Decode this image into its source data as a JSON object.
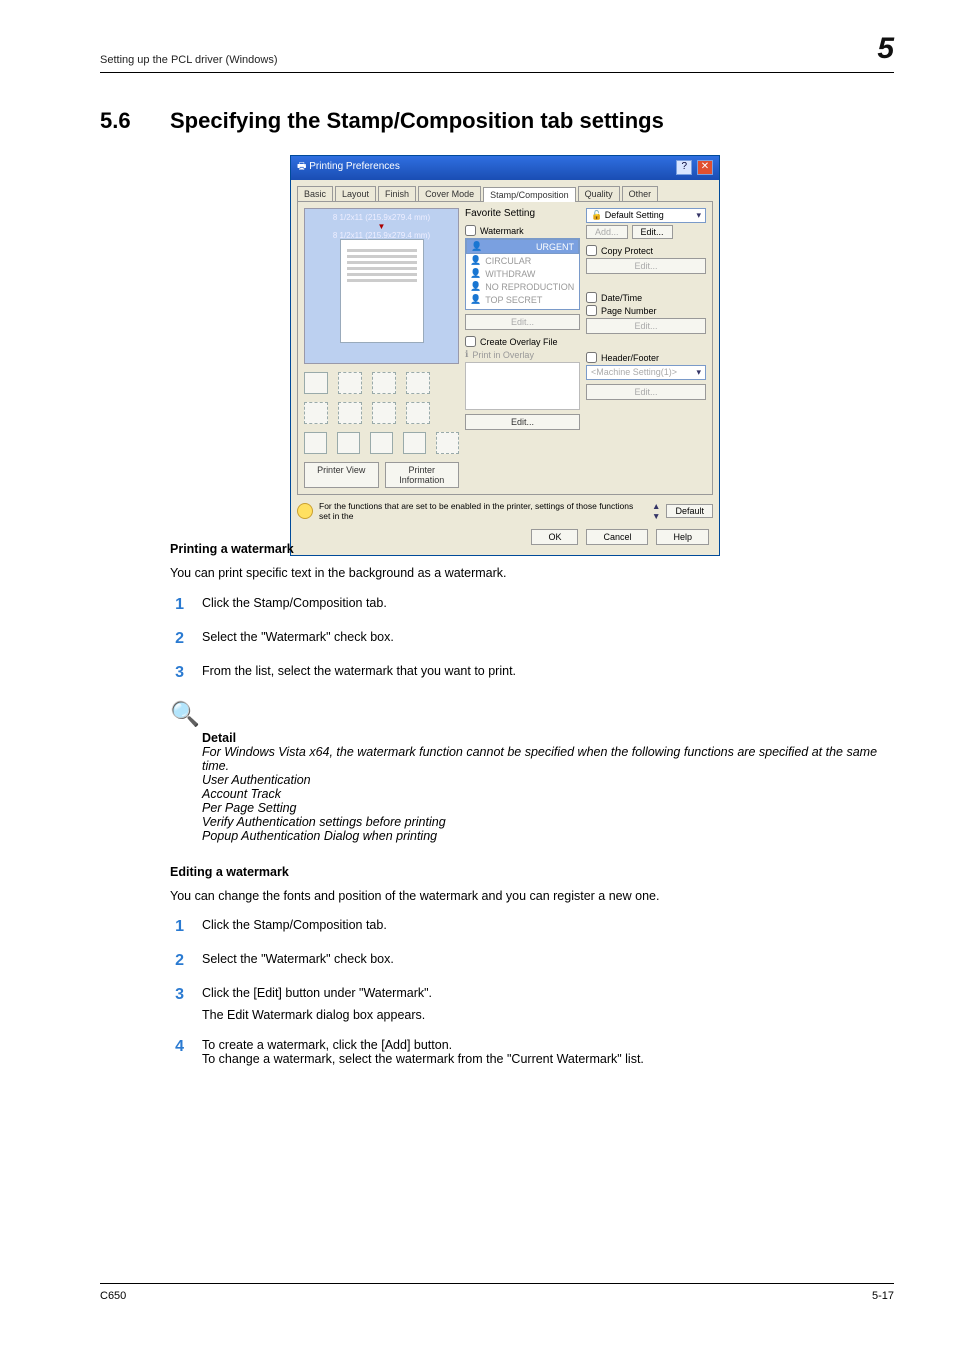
{
  "header": {
    "path": "Setting up the PCL driver (Windows)",
    "chapter_num": "5"
  },
  "section": {
    "number": "5.6",
    "title": "Specifying the Stamp/Composition tab settings"
  },
  "dialog": {
    "title": "Printing Preferences",
    "tabs": [
      "Basic",
      "Layout",
      "Finish",
      "Cover Mode",
      "Stamp/Composition",
      "Quality",
      "Other"
    ],
    "active_tab_index": 4,
    "preview": {
      "line1": "8 1/2x11 (215.9x279.4 mm)",
      "line2": "8 1/2x11 (215.9x279.4 mm)"
    },
    "left_buttons": {
      "printer_view": "Printer View",
      "printer_info": "Printer Information"
    },
    "favorite": {
      "label": "Favorite Setting",
      "value": "Default Setting",
      "add": "Add...",
      "edit": "Edit..."
    },
    "watermark": {
      "label": "Watermark",
      "items": [
        "URGENT",
        "CIRCULAR",
        "WITHDRAW",
        "NO REPRODUCTION",
        "TOP SECRET"
      ],
      "edit": "Edit..."
    },
    "overlay": {
      "create": "Create Overlay File",
      "print": "Print in Overlay",
      "edit": "Edit..."
    },
    "right": {
      "copy_protect": "Copy Protect",
      "cp_edit": "Edit...",
      "date_time": "Date/Time",
      "page_number": "Page Number",
      "dt_edit": "Edit...",
      "header_footer": "Header/Footer",
      "hf_value": "<Machine Setting(1)>",
      "hf_edit": "Edit..."
    },
    "hint": "For the functions that are set to be enabled in the printer, settings of those functions set in the",
    "default_btn": "Default",
    "buttons": {
      "ok": "OK",
      "cancel": "Cancel",
      "help": "Help"
    }
  },
  "blocks": {
    "b1": {
      "heading": "Printing a watermark",
      "para": "You can print specific text in the background as a watermark.",
      "steps": [
        "Click the Stamp/Composition tab.",
        "Select the \"Watermark\" check box.",
        "From the list, select the watermark that you want to print."
      ]
    },
    "detail": {
      "title": "Detail",
      "lines": [
        "For Windows Vista x64, the watermark function cannot be specified when the following functions are specified at the same time.",
        "User Authentication",
        "Account Track",
        "Per Page Setting",
        "Verify Authentication settings before printing",
        "Popup Authentication Dialog when printing"
      ]
    },
    "b2": {
      "heading": "Editing a watermark",
      "para": "You can change the fonts and position of the watermark and you can register a new one.",
      "steps": [
        "Click the Stamp/Composition tab.",
        "Select the \"Watermark\" check box.",
        "Click the [Edit] button under \"Watermark\".",
        "To create a watermark, click the [Add] button.\nTo change a watermark, select the watermark from the \"Current Watermark\" list."
      ],
      "step3_sub": "The Edit Watermark dialog box appears."
    }
  },
  "footer": {
    "left": "C650",
    "right": "5-17"
  }
}
